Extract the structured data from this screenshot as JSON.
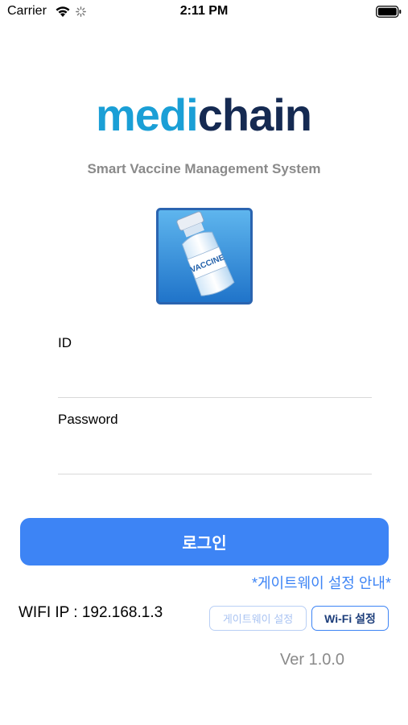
{
  "status_bar": {
    "carrier": "Carrier",
    "time": "2:11 PM",
    "icons": [
      "wifi-icon",
      "spinner-icon",
      "battery-icon"
    ]
  },
  "brand": {
    "logo_part1": "medi",
    "logo_part2": "chain",
    "logo_colors": {
      "medi": "#1a9fd6",
      "chain": "#152a52"
    },
    "tagline": "Smart Vaccine Management System",
    "app_icon": "vaccine-vial-icon",
    "app_icon_label": "VACCINE"
  },
  "login_form": {
    "id_label": "ID",
    "id_value": "",
    "password_label": "Password",
    "password_value": "",
    "login_button": "로그인"
  },
  "gateway": {
    "guide_link": "*게이트웨이 설정 안내*",
    "wifi_ip": "WIFI IP : 192.168.1.3",
    "gateway_button": "게이트웨이 설정",
    "wifi_button": "Wi-Fi 설정"
  },
  "version": "Ver 1.0.0",
  "colors": {
    "accent": "#3d84f5",
    "secondary_text": "#8a8a8a"
  }
}
